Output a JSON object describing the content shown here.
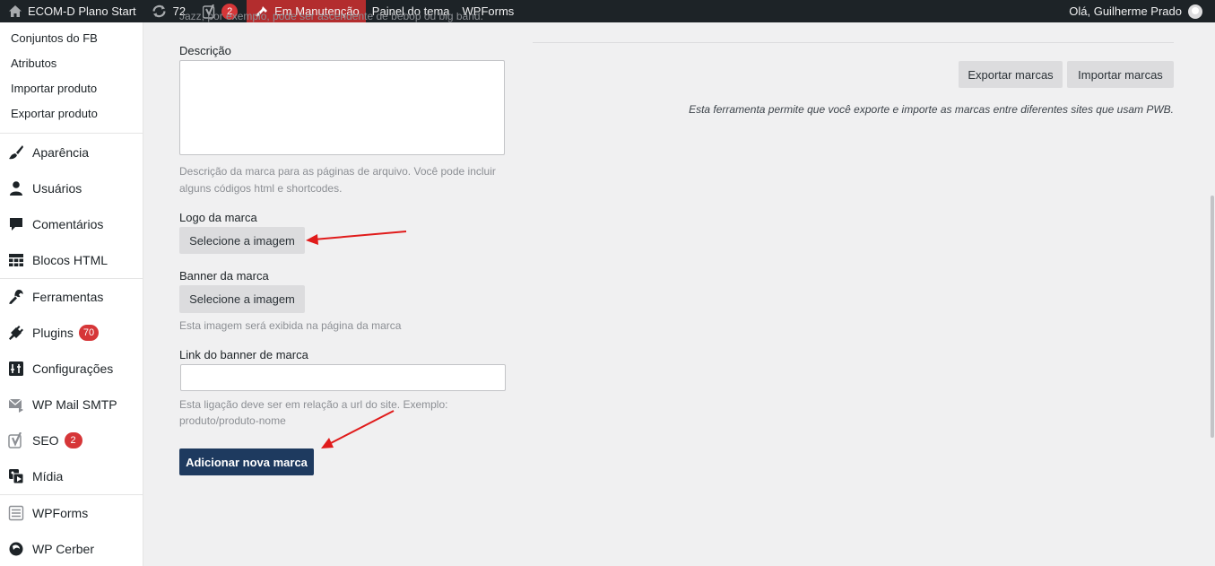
{
  "adminbar": {
    "site_name": "ECOM-D Plano Start",
    "updates_count": "72",
    "yoast_count": "2",
    "maintenance": "Em Manutenção",
    "theme_panel": "Painel do tema",
    "wpforms": "WPForms",
    "greeting": "Olá, Guilherme Prado"
  },
  "sidebar": {
    "submenu": [
      "Conjuntos do FB",
      "Atributos",
      "Importar produto",
      "Exportar produto"
    ],
    "items": [
      {
        "label": "Aparência",
        "icon": "paintbrush-icon"
      },
      {
        "label": "Usuários",
        "icon": "users-icon"
      },
      {
        "label": "Comentários",
        "icon": "comment-icon"
      },
      {
        "label": "Blocos HTML",
        "icon": "grid-icon"
      },
      {
        "label": "Ferramentas",
        "icon": "wrench-icon"
      },
      {
        "label": "Plugins",
        "icon": "plugin-icon",
        "badge": "70"
      },
      {
        "label": "Configurações",
        "icon": "settings-icon"
      },
      {
        "label": "WP Mail SMTP",
        "icon": "mail-icon"
      },
      {
        "label": "SEO",
        "icon": "yoast-icon",
        "badge": "2"
      },
      {
        "label": "Mídia",
        "icon": "media-icon"
      },
      {
        "label": "WPForms",
        "icon": "wpforms-icon"
      },
      {
        "label": "WP Cerber",
        "icon": "cerber-icon"
      }
    ]
  },
  "form": {
    "top_clipped_hint": "Jazz, por exemplo, pode ser ascendente de bebop ou big band.",
    "description_label": "Descrição",
    "description_value": "",
    "description_hint_1": "Descrição da marca para as páginas de arquivo. Você pode incluir",
    "description_hint_2": "alguns códigos html e shortcodes.",
    "logo_label": "Logo da marca",
    "logo_button": "Selecione a imagem",
    "banner_label": "Banner da marca",
    "banner_button": "Selecione a imagem",
    "banner_hint": "Esta imagem será exibida na página da marca",
    "link_label": "Link do banner de marca",
    "link_value": "",
    "link_hint_1": "Esta ligação deve ser em relação a url do site. Exemplo:",
    "link_hint_2": "produto/produto-nome",
    "submit_button": "Adicionar nova marca"
  },
  "tools": {
    "export_button": "Exportar marcas",
    "import_button": "Importar marcas",
    "note": "Esta ferramenta permite que você exporte e importe as marcas entre diferentes sites que usam PWB."
  },
  "colors": {
    "adminbar_bg": "#1d2327",
    "maintenance_bg": "#b32d2e",
    "primary_button": "#1e3a5f",
    "badge": "#d63638",
    "annotation_arrow": "#e01b1b"
  }
}
